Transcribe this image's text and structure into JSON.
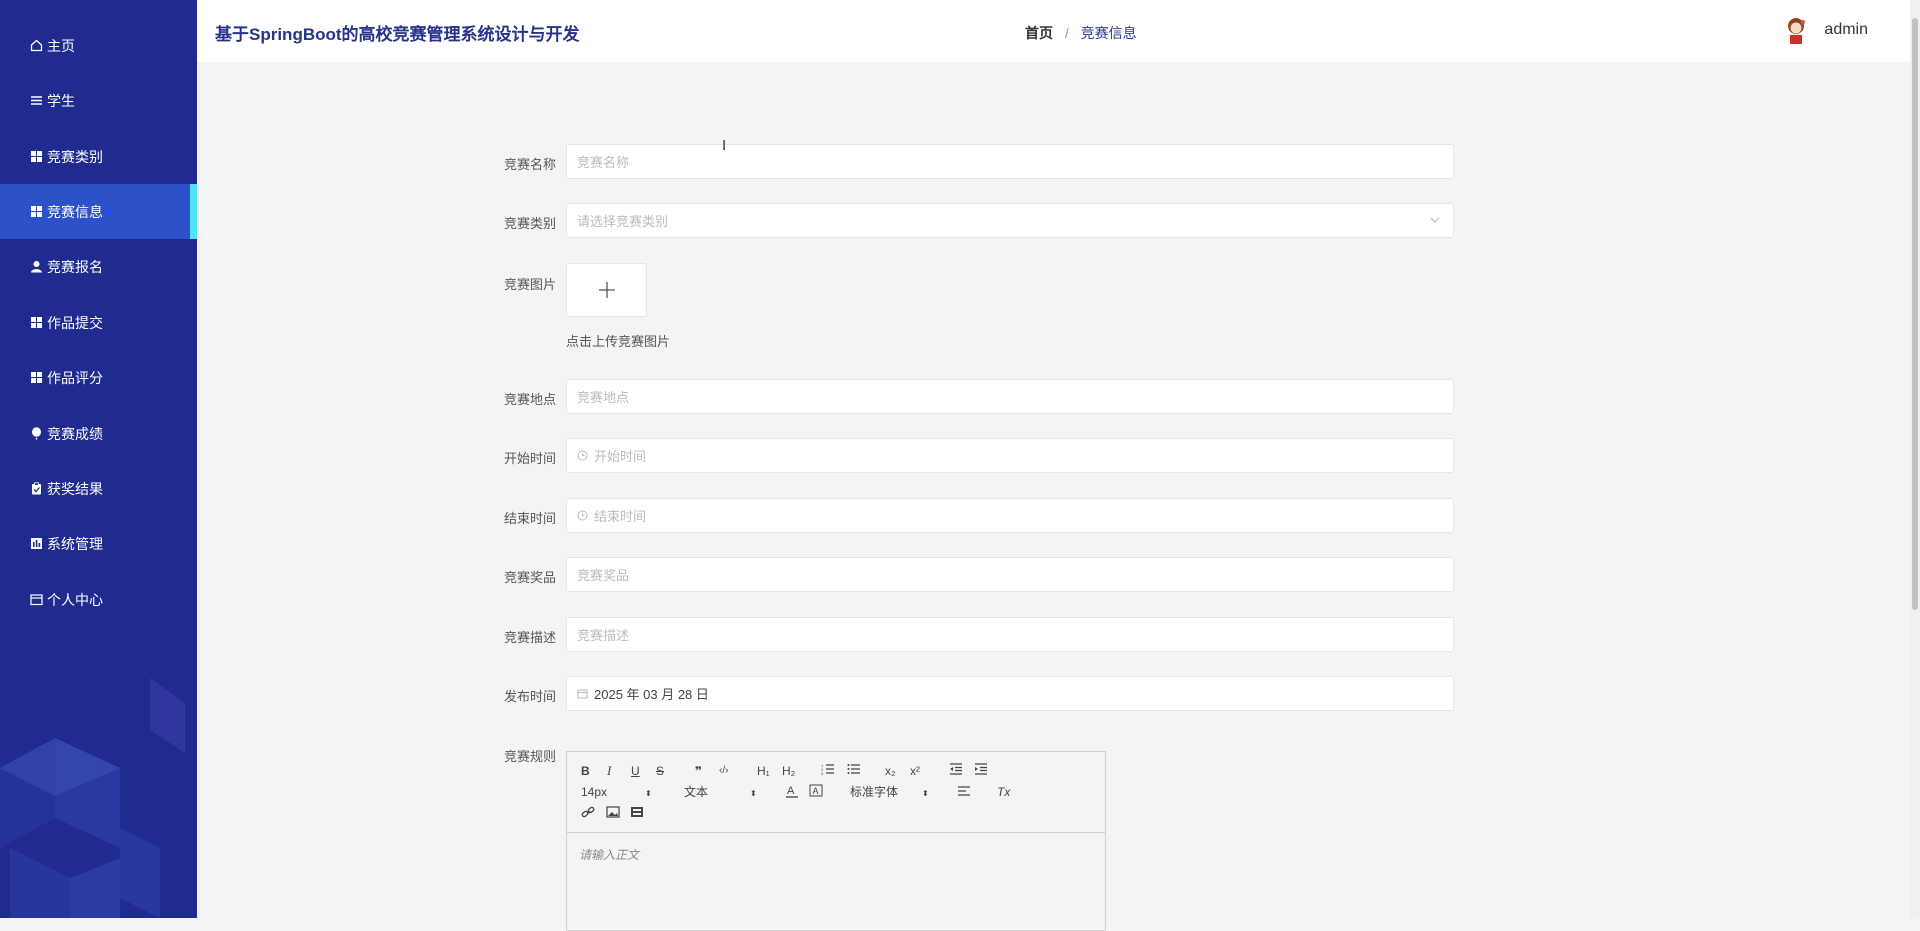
{
  "header": {
    "app_title": "基于SpringBoot的高校竞赛管理系统设计与开发",
    "breadcrumb": {
      "home": "首页",
      "separator": "/",
      "current": "竞赛信息"
    },
    "username": "admin"
  },
  "sidebar": {
    "items": [
      {
        "label": "主页",
        "icon": "home-icon"
      },
      {
        "label": "学生",
        "icon": "menu-lines-icon"
      },
      {
        "label": "竞赛类别",
        "icon": "grid-icon"
      },
      {
        "label": "竞赛信息",
        "icon": "grid-icon",
        "active": true
      },
      {
        "label": "竞赛报名",
        "icon": "user-icon"
      },
      {
        "label": "作品提交",
        "icon": "grid-icon"
      },
      {
        "label": "作品评分",
        "icon": "grid-icon"
      },
      {
        "label": "竞赛成绩",
        "icon": "balloon-icon"
      },
      {
        "label": "获奖结果",
        "icon": "clipboard-icon"
      },
      {
        "label": "系统管理",
        "icon": "chart-icon"
      },
      {
        "label": "个人中心",
        "icon": "card-icon"
      }
    ]
  },
  "form": {
    "name": {
      "label": "竞赛名称",
      "placeholder": "竞赛名称"
    },
    "category": {
      "label": "竞赛类别",
      "placeholder": "请选择竞赛类别"
    },
    "image": {
      "label": "竞赛图片",
      "upload_tip": "点击上传竞赛图片"
    },
    "location": {
      "label": "竞赛地点",
      "placeholder": "竞赛地点"
    },
    "start_time": {
      "label": "开始时间",
      "placeholder": "开始时间"
    },
    "end_time": {
      "label": "结束时间",
      "placeholder": "结束时间"
    },
    "prize": {
      "label": "竞赛奖品",
      "placeholder": "竞赛奖品"
    },
    "description": {
      "label": "竞赛描述",
      "placeholder": "竞赛描述"
    },
    "publish_time": {
      "label": "发布时间",
      "value": "2025 年 03 月 28 日"
    },
    "rules": {
      "label": "竞赛规则",
      "toolbar": {
        "bold": "B",
        "italic": "I",
        "underline": "U",
        "strike": "S",
        "quote": "❞",
        "code": "‹/›",
        "h1": "H₁",
        "h2": "H₂",
        "sub": "x₂",
        "sup": "x²",
        "size": "14px",
        "format": "文本",
        "font": "标准字体",
        "clean": "Tx"
      },
      "placeholder": "请输入正文"
    }
  },
  "colors": {
    "sidebar_bg": "#1f2b8f",
    "sidebar_active": "#2c51c9",
    "active_indicator": "#4fe3f5",
    "title": "#26338a"
  }
}
